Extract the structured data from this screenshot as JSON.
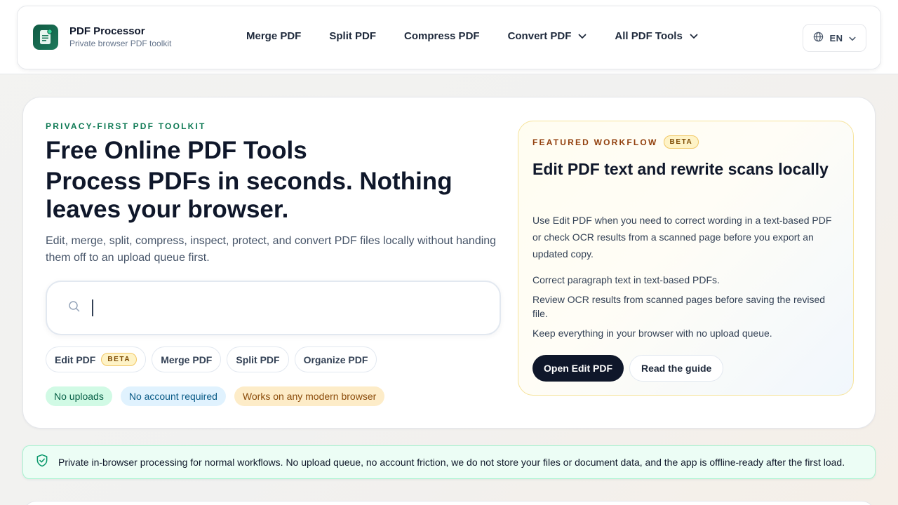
{
  "header": {
    "brand_title": "PDF Processor",
    "brand_subtitle": "Private browser PDF toolkit",
    "nav": [
      "Merge PDF",
      "Split PDF",
      "Compress PDF",
      "Convert PDF",
      "All PDF Tools"
    ],
    "language": "EN"
  },
  "hero": {
    "eyebrow": "PRIVACY-FIRST PDF TOOLKIT",
    "title_line1": "Free Online PDF Tools",
    "title_line2": "Process PDFs in seconds. Nothing leaves your browser.",
    "lead": "Edit, merge, split, compress, inspect, protect, and convert PDF files locally without handing them off to an upload queue first.",
    "search_placeholder": "",
    "chips": [
      "Edit PDF",
      "Merge PDF",
      "Split PDF",
      "Organize PDF"
    ],
    "beta_label": "BETA",
    "pills": [
      "No uploads",
      "No account required",
      "Works on any modern browser"
    ]
  },
  "featured": {
    "eyebrow": "FEATURED WORKFLOW",
    "badge": "BETA",
    "title": "Edit PDF text and rewrite scans locally",
    "description": "Use Edit PDF when you need to correct wording in a text-based PDF or check OCR results from a scanned page before you export an updated copy.",
    "bullets": [
      "Correct paragraph text in text-based PDFs.",
      "Review OCR results from scanned pages before saving the revised file.",
      "Keep everything in your browser with no upload queue."
    ],
    "primary_button": "Open Edit PDF",
    "secondary_button": "Read the guide"
  },
  "banner": {
    "text": "Private in-browser processing for normal workflows. No upload queue, no account friction, we do not store your files or document data, and the app is offline-ready after the first load."
  },
  "colors": {
    "accent_green": "#0f7a55",
    "dark": "#0f172a",
    "beta_bg": "#fef3c7"
  },
  "icons": {
    "logo": "document-icon",
    "language": "globe-icon",
    "search": "search-icon",
    "banner": "shield-check-icon",
    "dropdown": "chevron-down-icon"
  }
}
